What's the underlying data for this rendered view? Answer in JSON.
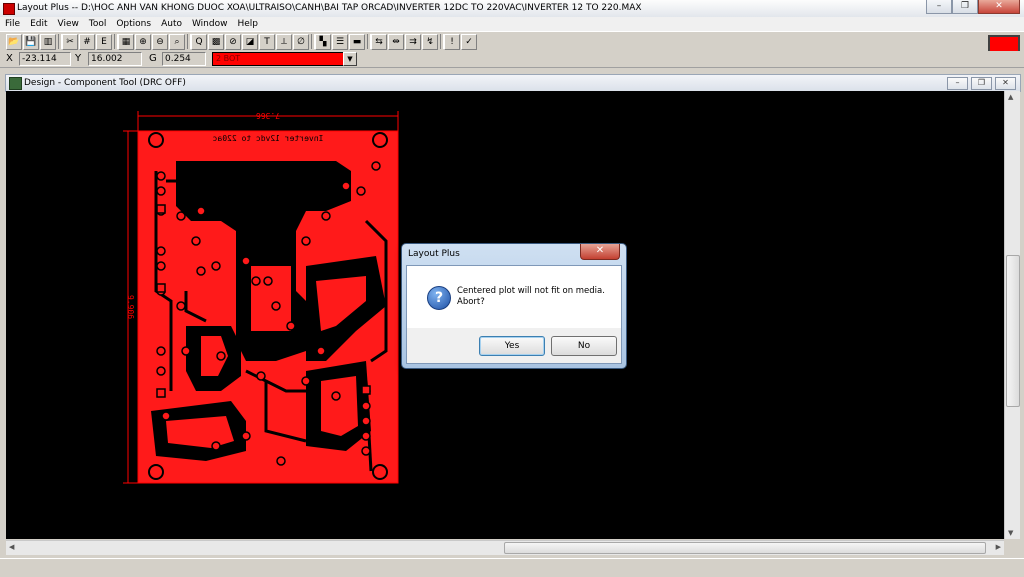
{
  "window": {
    "title": "Layout Plus -- D:\\HOC ANH VAN KHONG DUOC XOA\\ULTRAISO\\CANH\\BAI TAP  ORCAD\\INVERTER 12DC TO 220VAC\\INVERTER 12 TO 220.MAX",
    "minimize": "–",
    "restore": "❐",
    "close": "✕"
  },
  "menu": [
    "File",
    "Edit",
    "View",
    "Tool",
    "Options",
    "Auto",
    "Window",
    "Help"
  ],
  "toolbar": {
    "buttons": [
      {
        "name": "open-icon",
        "glyph": "📂"
      },
      {
        "name": "save-icon",
        "glyph": "💾"
      },
      {
        "name": "reports-icon",
        "glyph": "▥"
      },
      {
        "name": "cut-icon",
        "glyph": "✂"
      },
      {
        "name": "query-icon",
        "glyph": "#"
      },
      {
        "name": "edit-icon",
        "glyph": "E"
      },
      {
        "name": "spreadsheet-icon",
        "glyph": "▦"
      },
      {
        "name": "zoom-in-icon",
        "glyph": "⊕"
      },
      {
        "name": "zoom-out-icon",
        "glyph": "⊖"
      },
      {
        "name": "zoom-all-icon",
        "glyph": "⌕"
      },
      {
        "name": "query-window-icon",
        "glyph": "Q"
      },
      {
        "name": "grid-icon",
        "glyph": "▩"
      },
      {
        "name": "component-tool-icon",
        "glyph": "⊘"
      },
      {
        "name": "pad-tool-icon",
        "glyph": "◪"
      },
      {
        "name": "text-tool-icon",
        "glyph": "T"
      },
      {
        "name": "dimension-tool-icon",
        "glyph": "⟂"
      },
      {
        "name": "drc-icon",
        "glyph": "∅"
      },
      {
        "name": "color-icon",
        "glyph": "▚"
      },
      {
        "name": "layer-icon",
        "glyph": "☰"
      },
      {
        "name": "route-icon",
        "glyph": "▬"
      },
      {
        "name": "auto-route-icon",
        "glyph": "⇆"
      },
      {
        "name": "shove-icon",
        "glyph": "⇹"
      },
      {
        "name": "connect-icon",
        "glyph": "⇉"
      },
      {
        "name": "reconnect-icon",
        "glyph": "↯"
      },
      {
        "name": "error-icon",
        "glyph": "!"
      },
      {
        "name": "check-icon",
        "glyph": "✓"
      }
    ]
  },
  "accent_color": "#ff0000",
  "coords": {
    "x_label": "X",
    "x_value": "-23.114",
    "y_label": "Y",
    "y_value": "16.002",
    "g_label": "G",
    "g_value": "0.254",
    "layer": "2  BOT"
  },
  "design_window": {
    "title": "Design - Component Tool (DRC OFF)"
  },
  "board": {
    "text_top": "Inverter 12vdc to 220ac",
    "dim_width": "7.366",
    "dim_height": "9.906"
  },
  "dialog": {
    "title": "Layout Plus",
    "message": "Centered plot will not fit on media.\nAbort?",
    "yes_label": "Yes",
    "no_label": "No",
    "close": "✕",
    "question_mark": "?"
  }
}
